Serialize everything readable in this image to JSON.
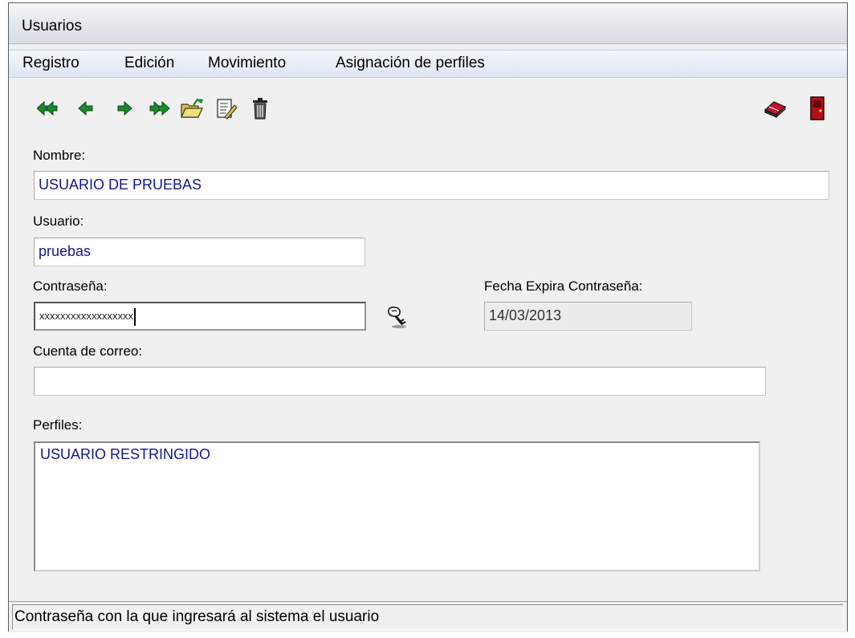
{
  "window": {
    "title": "Usuarios"
  },
  "menu": {
    "items": [
      "Registro",
      "Edición",
      "Movimiento",
      "Asignación de perfiles"
    ]
  },
  "toolbar": {
    "buttons": [
      {
        "icon": "first-record-icon"
      },
      {
        "icon": "previous-record-icon"
      },
      {
        "icon": "next-record-icon"
      },
      {
        "icon": "last-record-icon"
      },
      {
        "icon": "open-folder-icon"
      },
      {
        "icon": "edit-document-icon"
      },
      {
        "icon": "trash-icon"
      },
      {
        "icon": "eraser-icon"
      },
      {
        "icon": "exit-door-icon"
      }
    ]
  },
  "form": {
    "nombre_label": "Nombre:",
    "nombre_value": "USUARIO DE PRUEBAS",
    "usuario_label": "Usuario:",
    "usuario_value": "pruebas",
    "contrasena_label": "Contraseña:",
    "contrasena_value": "xxxxxxxxxxxxxxxxxx",
    "fecha_label": "Fecha Expira Contraseña:",
    "fecha_value": "14/03/2013",
    "correo_label": "Cuenta de correo:",
    "correo_value": "",
    "perfiles_label": "Perfiles:",
    "perfiles_items": [
      "USUARIO RESTRINGIDO"
    ]
  },
  "status": {
    "text": "Contraseña con la que ingresará al sistema el usuario"
  },
  "colors": {
    "field_text": "#15168c",
    "arrow_green": "#1a8a2e",
    "door_red": "#c0101a"
  }
}
